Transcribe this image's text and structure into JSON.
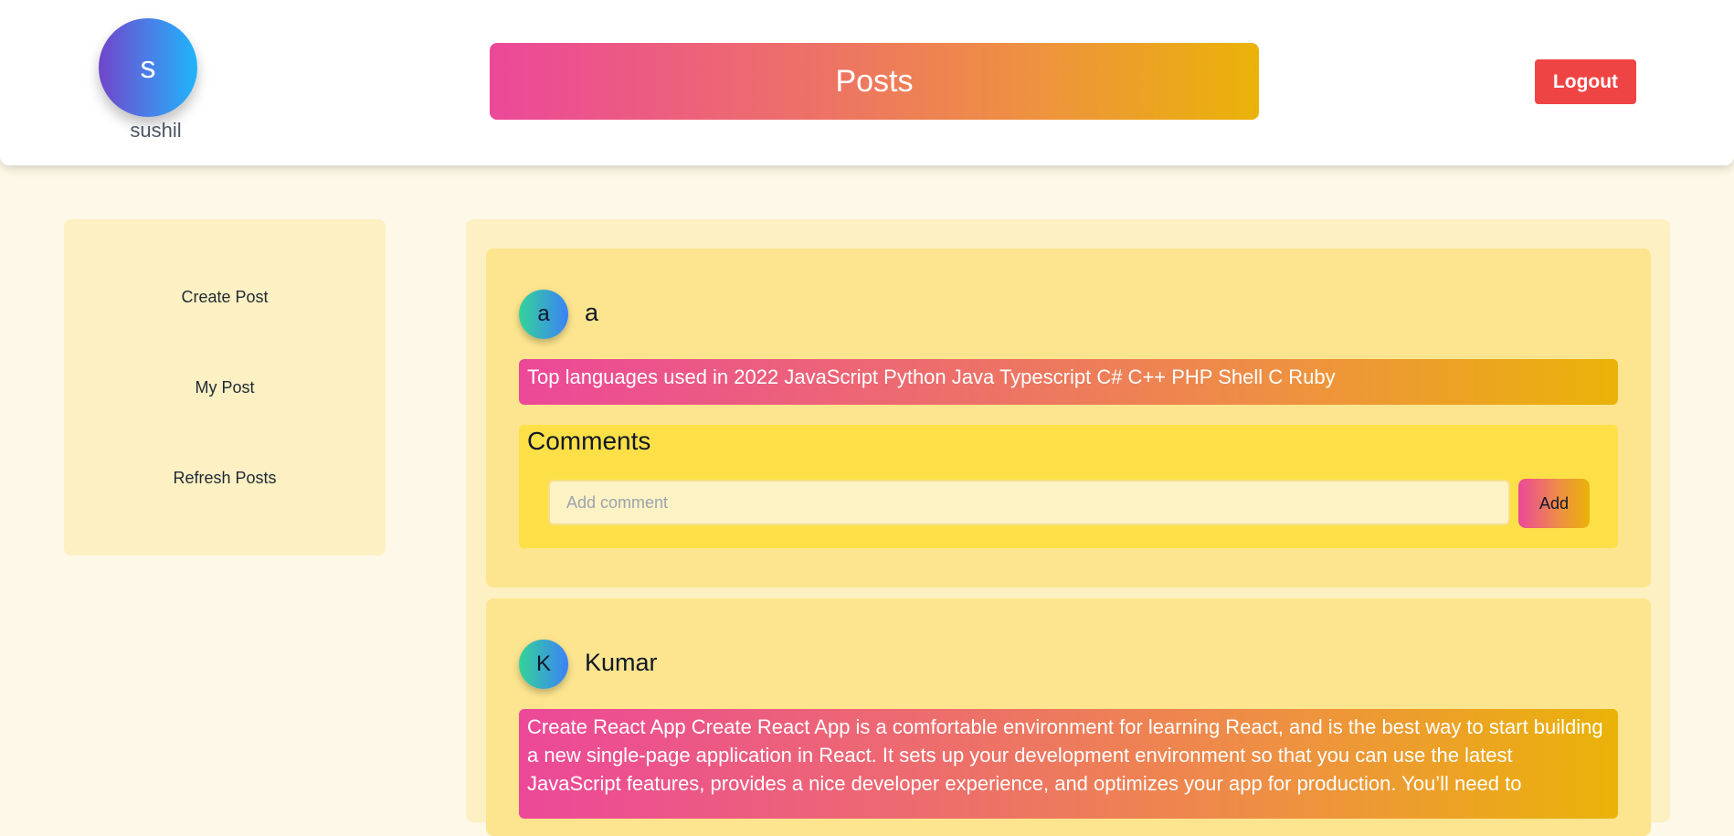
{
  "header": {
    "user_initial": "s",
    "username": "sushil",
    "title": "Posts",
    "logout_label": "Logout"
  },
  "sidebar": {
    "items": [
      {
        "label": "Create Post"
      },
      {
        "label": "My Post"
      },
      {
        "label": "Refresh Posts"
      }
    ]
  },
  "posts": [
    {
      "author_initial": "a",
      "author": "a",
      "content": "Top languages used in 2022 JavaScript Python Java Typescript C# C++ PHP Shell C Ruby",
      "comments_title": "Comments",
      "comment_placeholder": "Add comment",
      "add_label": "Add"
    },
    {
      "author_initial": "K",
      "author": "Kumar",
      "content": "Create React App Create React App is a comfortable environment for learning React, and is the best way to start building a new single-page application in React. It sets up your development environment so that you can use the latest JavaScript features, provides a nice developer experience, and optimizes your app for production. You’ll need to"
    }
  ],
  "colors": {
    "page_background": "#fdf8e7",
    "logout": "#ef4444",
    "gradient_start": "#ec4899",
    "gradient_end": "#eab308",
    "comments_box": "#fde047"
  }
}
